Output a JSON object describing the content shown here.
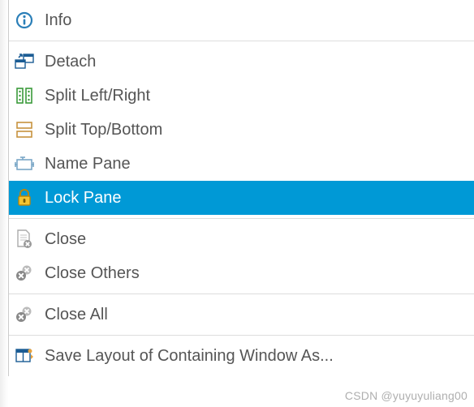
{
  "menu": {
    "groups": [
      {
        "items": [
          {
            "id": "info",
            "label": "Info",
            "icon": "info-icon"
          }
        ]
      },
      {
        "items": [
          {
            "id": "detach",
            "label": "Detach",
            "icon": "detach-icon"
          },
          {
            "id": "split-lr",
            "label": "Split Left/Right",
            "icon": "split-lr-icon"
          },
          {
            "id": "split-tb",
            "label": "Split Top/Bottom",
            "icon": "split-tb-icon"
          },
          {
            "id": "name-pane",
            "label": "Name Pane",
            "icon": "name-pane-icon"
          },
          {
            "id": "lock-pane",
            "label": "Lock Pane",
            "icon": "lock-icon",
            "highlighted": true
          }
        ]
      },
      {
        "items": [
          {
            "id": "close",
            "label": "Close",
            "icon": "close-doc-icon"
          },
          {
            "id": "close-others",
            "label": "Close Others",
            "icon": "close-others-icon"
          }
        ]
      },
      {
        "items": [
          {
            "id": "close-all",
            "label": "Close All",
            "icon": "close-all-icon"
          }
        ]
      },
      {
        "items": [
          {
            "id": "save-layout",
            "label": "Save Layout of Containing Window As...",
            "icon": "save-layout-icon"
          }
        ]
      }
    ]
  },
  "colors": {
    "highlight": "#0099d6"
  },
  "watermark": "CSDN @yuyuyuliang00"
}
